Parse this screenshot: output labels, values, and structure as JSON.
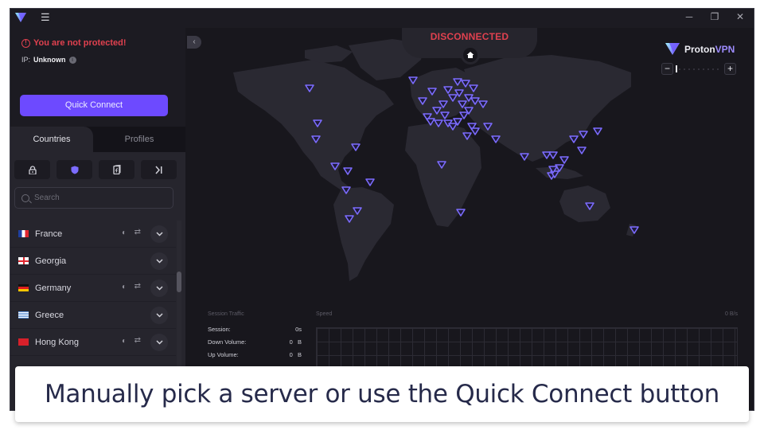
{
  "app": {
    "window_controls": {
      "minimize": "─",
      "restore": "❐",
      "close": "✕"
    },
    "menu_icon": "☰"
  },
  "sidebar": {
    "protection_warning": "You are not protected!",
    "ip_label": "IP:",
    "ip_value": "Unknown",
    "quick_connect_label": "Quick Connect",
    "tabs": [
      {
        "label": "Countries",
        "active": true
      },
      {
        "label": "Profiles",
        "active": false
      }
    ],
    "filters": [
      {
        "name": "secure-core-filter",
        "icon": "lock-icon"
      },
      {
        "name": "netshield-filter",
        "icon": "shield-icon",
        "active": true
      },
      {
        "name": "p2p-filter",
        "icon": "p2p-icon"
      },
      {
        "name": "tor-filter",
        "icon": "arrow-bar-icon"
      }
    ],
    "search_placeholder": "Search",
    "countries": [
      {
        "name": "France",
        "flag": "fr",
        "features": true
      },
      {
        "name": "Georgia",
        "flag": "ge",
        "features": false
      },
      {
        "name": "Germany",
        "flag": "de",
        "features": true
      },
      {
        "name": "Greece",
        "flag": "gr",
        "features": false
      },
      {
        "name": "Hong Kong",
        "flag": "hk",
        "features": true
      }
    ]
  },
  "map": {
    "status": "DISCONNECTED",
    "brand_name": "Proton",
    "brand_suffix": "VPN",
    "zoom_minus": "−",
    "zoom_plus": "+",
    "collapse_icon": "‹"
  },
  "traffic": {
    "title": "Session Traffic",
    "speed_label": "Speed",
    "speed_value": "0 B/s",
    "stats": [
      {
        "label": "Session:",
        "value": "0s"
      },
      {
        "label": "Down Volume:",
        "value": "0   B"
      },
      {
        "label": "Up Volume:",
        "value": "0   B"
      }
    ]
  },
  "caption": "Manually pick a server or use the Quick Connect button",
  "colors": {
    "accent": "#6d4aff",
    "danger": "#e0414f",
    "background": "#1c1b22",
    "marker": "#7c6cff"
  }
}
